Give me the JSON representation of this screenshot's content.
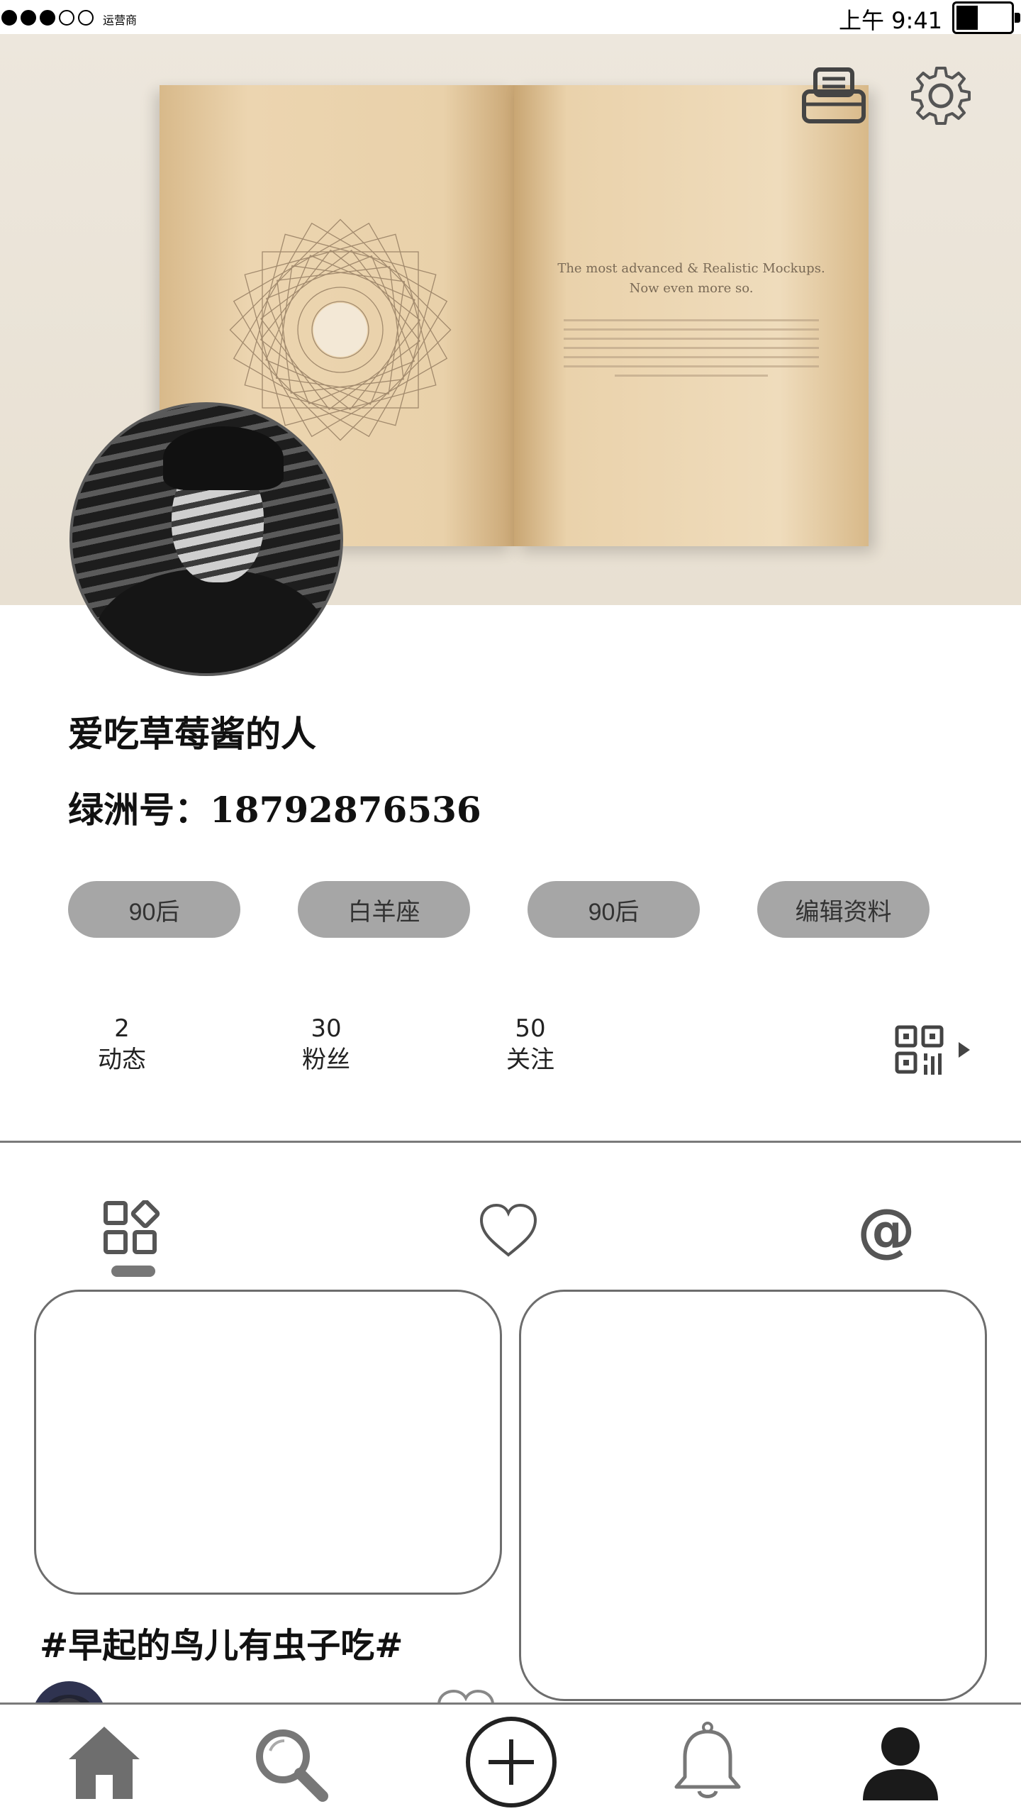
{
  "status_bar": {
    "carrier": "运营商",
    "time": "上午 9:41"
  },
  "cover": {
    "book_line1": "The most advanced & Realistic Mockups.",
    "book_line2": "Now even more so."
  },
  "profile": {
    "username": "爱吃草莓酱的人",
    "oasis_label": "绿洲号：",
    "oasis_id": "18792876536"
  },
  "tags": [
    "90后",
    "白羊座",
    "90后",
    "编辑资料"
  ],
  "stats": [
    {
      "count": "2",
      "label": "动态"
    },
    {
      "count": "30",
      "label": "粉丝"
    },
    {
      "count": "50",
      "label": "关注"
    }
  ],
  "content_tabs": {
    "mentions_symbol": "@"
  },
  "feed": {
    "card_title": "#早起的鸟儿有虫子吃#"
  },
  "colors": {
    "tag_bg": "#a6a6a6",
    "icon_gray": "#555555",
    "divider": "#7a7a7a"
  }
}
